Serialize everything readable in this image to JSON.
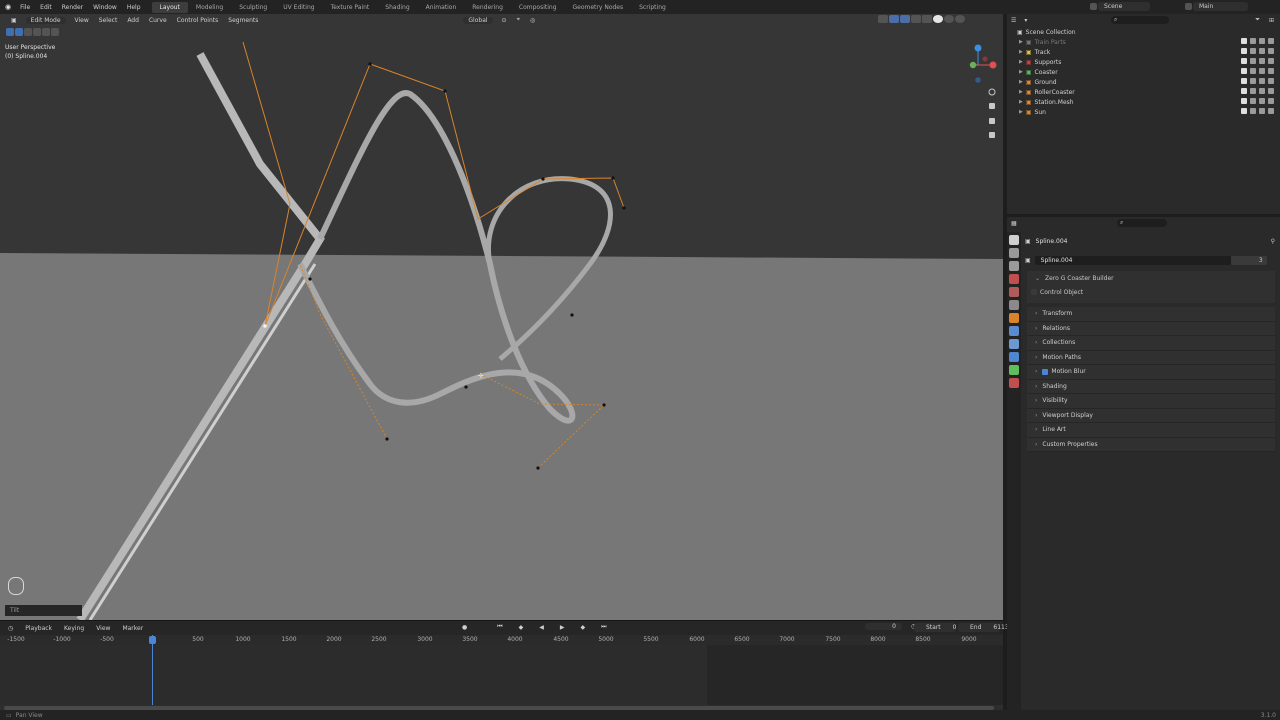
{
  "topbar": {
    "menus": [
      "File",
      "Edit",
      "Render",
      "Window",
      "Help"
    ],
    "workspaces": [
      "Layout",
      "Modeling",
      "Sculpting",
      "UV Editing",
      "Texture Paint",
      "Shading",
      "Animation",
      "Rendering",
      "Compositing",
      "Geometry Nodes",
      "Scripting"
    ],
    "active_workspace": "Layout",
    "scene": "Scene",
    "view_layer": "Main"
  },
  "viewport": {
    "mode": "Edit Mode",
    "menus": [
      "View",
      "Select",
      "Add",
      "Curve",
      "Control Points",
      "Segments"
    ],
    "orientation": "Global",
    "perspective_label": "User Perspective",
    "object_label": "(0) Spline.004",
    "hint_text": "Tilt"
  },
  "outliner": {
    "title": "Scene Collection",
    "items": [
      {
        "name": "Train Parts",
        "color": "#7a7a7a"
      },
      {
        "name": "Track",
        "color": "#e0c34a"
      },
      {
        "name": "Supports",
        "color": "#d04040"
      },
      {
        "name": "Coaster",
        "color": "#5fbf5f"
      },
      {
        "name": "Ground",
        "color": "#e08a3a"
      },
      {
        "name": "RollerCoaster",
        "color": "#e08a3a"
      },
      {
        "name": "Station.Mesh",
        "color": "#e08a3a"
      },
      {
        "name": "Sun",
        "color": "#e08a3a"
      }
    ]
  },
  "properties": {
    "object_name": "Spline.004",
    "datablock_name": "Spline.004",
    "user_count": "3",
    "addon_panel": "Zero G Coaster Builder",
    "control_object": "Control Object",
    "panels": [
      "Transform",
      "Relations",
      "Collections",
      "Motion Paths",
      "Motion Blur",
      "Shading",
      "Visibility",
      "Viewport Display",
      "Line Art",
      "Custom Properties"
    ]
  },
  "timeline": {
    "menus": [
      "Playback",
      "Keying",
      "View",
      "Marker"
    ],
    "current_frame": "0",
    "start_label": "Start",
    "start_value": "0",
    "end_label": "End",
    "end_value": "6113",
    "ruler": [
      "-1500",
      "-1000",
      "-500",
      "0",
      "500",
      "1000",
      "1500",
      "2000",
      "2500",
      "3000",
      "3500",
      "4000",
      "4500",
      "5000",
      "5500",
      "6000",
      "6500",
      "7000",
      "7500",
      "8000",
      "8500",
      "9000"
    ]
  },
  "statusbar": {
    "left": "Pan View",
    "right": "3.1.0"
  }
}
